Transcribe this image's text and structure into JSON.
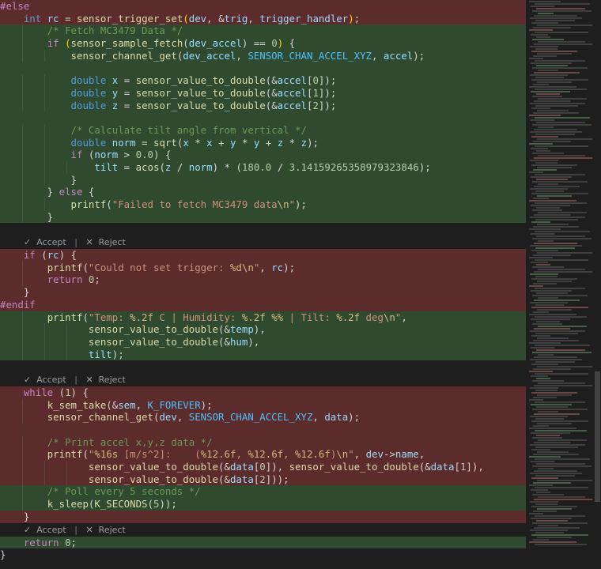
{
  "code": [
    {
      "kind": "del",
      "html": "<span class='pp'>#else</span>"
    },
    {
      "kind": "del",
      "html": "    <span class='k'>int</span> <span class='v'>rc</span> = <span class='f'>sensor_trigger_set</span><span class='p'>(</span><span class='v'>dev</span>, &amp;<span class='v'>trig</span>, <span class='v'>trigger_handler</span><span class='p'>)</span>;"
    },
    {
      "kind": "add",
      "html": "        <span class='c'>/* Fetch MC3479 Data */</span>"
    },
    {
      "kind": "add",
      "html": "        <span class='kc'>if</span> <span class='p'>(</span><span class='f'>sensor_sample_fetch</span>(<span class='v'>dev_accel</span>) == <span class='n'>0</span><span class='p'>)</span> {"
    },
    {
      "kind": "add",
      "html": "            <span class='f'>sensor_channel_get</span>(<span class='v'>dev_accel</span>, <span class='m'>SENSOR_CHAN_ACCEL_XYZ</span>, <span class='v'>accel</span>);"
    },
    {
      "kind": "add",
      "html": " "
    },
    {
      "kind": "add",
      "html": "            <span class='k'>double</span> <span class='v'>x</span> = <span class='f'>sensor_value_to_double</span>(&amp;<span class='v'>accel</span>[<span class='n'>0</span>]);"
    },
    {
      "kind": "add",
      "html": "            <span class='k'>double</span> <span class='v'>y</span> = <span class='f'>sensor_value_to_double</span>(&amp;<span class='v'>accel</span>[<span class='n'>1</span>]);"
    },
    {
      "kind": "add",
      "html": "            <span class='k'>double</span> <span class='v'>z</span> = <span class='f'>sensor_value_to_double</span>(&amp;<span class='v'>accel</span>[<span class='n'>2</span>]);"
    },
    {
      "kind": "add",
      "html": " "
    },
    {
      "kind": "add",
      "html": "            <span class='c'>/* Calculate tilt angle from vertical */</span>"
    },
    {
      "kind": "add",
      "html": "            <span class='k'>double</span> <span class='v'>norm</span> = <span class='f'>sqrt</span>(<span class='v'>x</span> * <span class='v'>x</span> + <span class='v'>y</span> * <span class='v'>y</span> + <span class='v'>z</span> * <span class='v'>z</span>);"
    },
    {
      "kind": "add",
      "html": "            <span class='kc'>if</span> (<span class='v'>norm</span> &gt; <span class='n'>0.0</span>) {"
    },
    {
      "kind": "add",
      "html": "                <span class='v'>tilt</span> = <span class='f'>acos</span>(<span class='v'>z</span> / <span class='v'>norm</span>) * (<span class='n'>180.0</span> / <span class='n'>3.14159265358979323846</span>);"
    },
    {
      "kind": "add",
      "html": "            }"
    },
    {
      "kind": "add",
      "html": "        } <span class='kc'>else</span> {"
    },
    {
      "kind": "add",
      "html": "            <span class='f'>printf</span>(<span class='s'>\"Failed to fetch MC3479 data</span><span class='e'>\\n</span><span class='s'>\"</span>);"
    },
    {
      "kind": "add",
      "html": "        }"
    },
    {
      "kind": "blank",
      "html": " "
    },
    {
      "kind": "widget"
    },
    {
      "kind": "del",
      "html": "    <span class='kc'>if</span> (<span class='v'>rc</span>) {"
    },
    {
      "kind": "del",
      "html": "        <span class='f'>printf</span>(<span class='s'>\"Could not set trigger: </span><span class='e'>%d\\n</span><span class='s'>\"</span>, <span class='v'>rc</span>);"
    },
    {
      "kind": "del",
      "html": "        <span class='kc'>return</span> <span class='n'>0</span>;"
    },
    {
      "kind": "del",
      "html": "    }"
    },
    {
      "kind": "del",
      "html": "<span class='pp'>#endif</span>"
    },
    {
      "kind": "add",
      "html": "        <span class='f'>printf</span>(<span class='s'>\"Temp: </span><span class='e'>%.2f</span><span class='s'> C | Humidity: </span><span class='e'>%.2f %%</span><span class='s'> | Tilt: </span><span class='e'>%.2f</span><span class='s'> deg</span><span class='e'>\\n</span><span class='s'>\"</span>,"
    },
    {
      "kind": "add",
      "html": "               <span class='f'>sensor_value_to_double</span>(&amp;<span class='v'>temp</span>),"
    },
    {
      "kind": "add",
      "html": "               <span class='f'>sensor_value_to_double</span>(&amp;<span class='v'>hum</span>),"
    },
    {
      "kind": "add",
      "html": "               <span class='v'>tilt</span>);"
    },
    {
      "kind": "blank",
      "html": " "
    },
    {
      "kind": "widget"
    },
    {
      "kind": "del",
      "html": "    <span class='kc'>while</span> (<span class='n'>1</span>) {"
    },
    {
      "kind": "del",
      "html": "        <span class='f'>k_sem_take</span>(&amp;<span class='v'>sem</span>, <span class='m'>K_FOREVER</span>);"
    },
    {
      "kind": "del",
      "html": "        <span class='f'>sensor_channel_get</span>(<span class='v'>dev</span>, <span class='m'>SENSOR_CHAN_ACCEL_XYZ</span>, <span class='v'>data</span>);"
    },
    {
      "kind": "del",
      "html": " "
    },
    {
      "kind": "del",
      "html": "        <span class='c'>/* Print accel x,y,z data */</span>"
    },
    {
      "kind": "del",
      "html": "        <span class='f'>printf</span>(<span class='s'>\"</span><span class='e'>%16s</span><span class='s'> [m/s^2]:    (</span><span class='e'>%12.6f</span><span class='s'>, </span><span class='e'>%12.6f</span><span class='s'>, </span><span class='e'>%12.6f</span><span class='s'>)</span><span class='e'>\\n</span><span class='s'>\"</span>, <span class='v'>dev</span>-&gt;<span class='v'>name</span>,"
    },
    {
      "kind": "del",
      "html": "               <span class='f'>sensor_value_to_double</span>(&amp;<span class='v'>data</span>[<span class='n'>0</span>]), <span class='f'>sensor_value_to_double</span>(&amp;<span class='v'>data</span>[<span class='n'>1</span>]),"
    },
    {
      "kind": "del",
      "html": "               <span class='f'>sensor_value_to_double</span>(&amp;<span class='v'>data</span>[<span class='n'>2</span>]));"
    },
    {
      "kind": "add",
      "html": "        <span class='c'>/* Poll every 5 seconds */</span>"
    },
    {
      "kind": "add",
      "html": "        <span class='f'>k_sleep</span>(<span class='f'>K_SECONDS</span>(<span class='n'>5</span>));"
    },
    {
      "kind": "del",
      "html": "    }"
    },
    {
      "kind": "widget"
    },
    {
      "kind": "add",
      "html": "    <span class='kc'>return</span> <span class='n'>0</span>;"
    },
    {
      "kind": "blank",
      "html": "}"
    }
  ],
  "diff_widget": {
    "accept_icon": "✓",
    "accept_label": "Accept",
    "separator": "|",
    "reject_icon": "✕",
    "reject_label": "Reject"
  }
}
